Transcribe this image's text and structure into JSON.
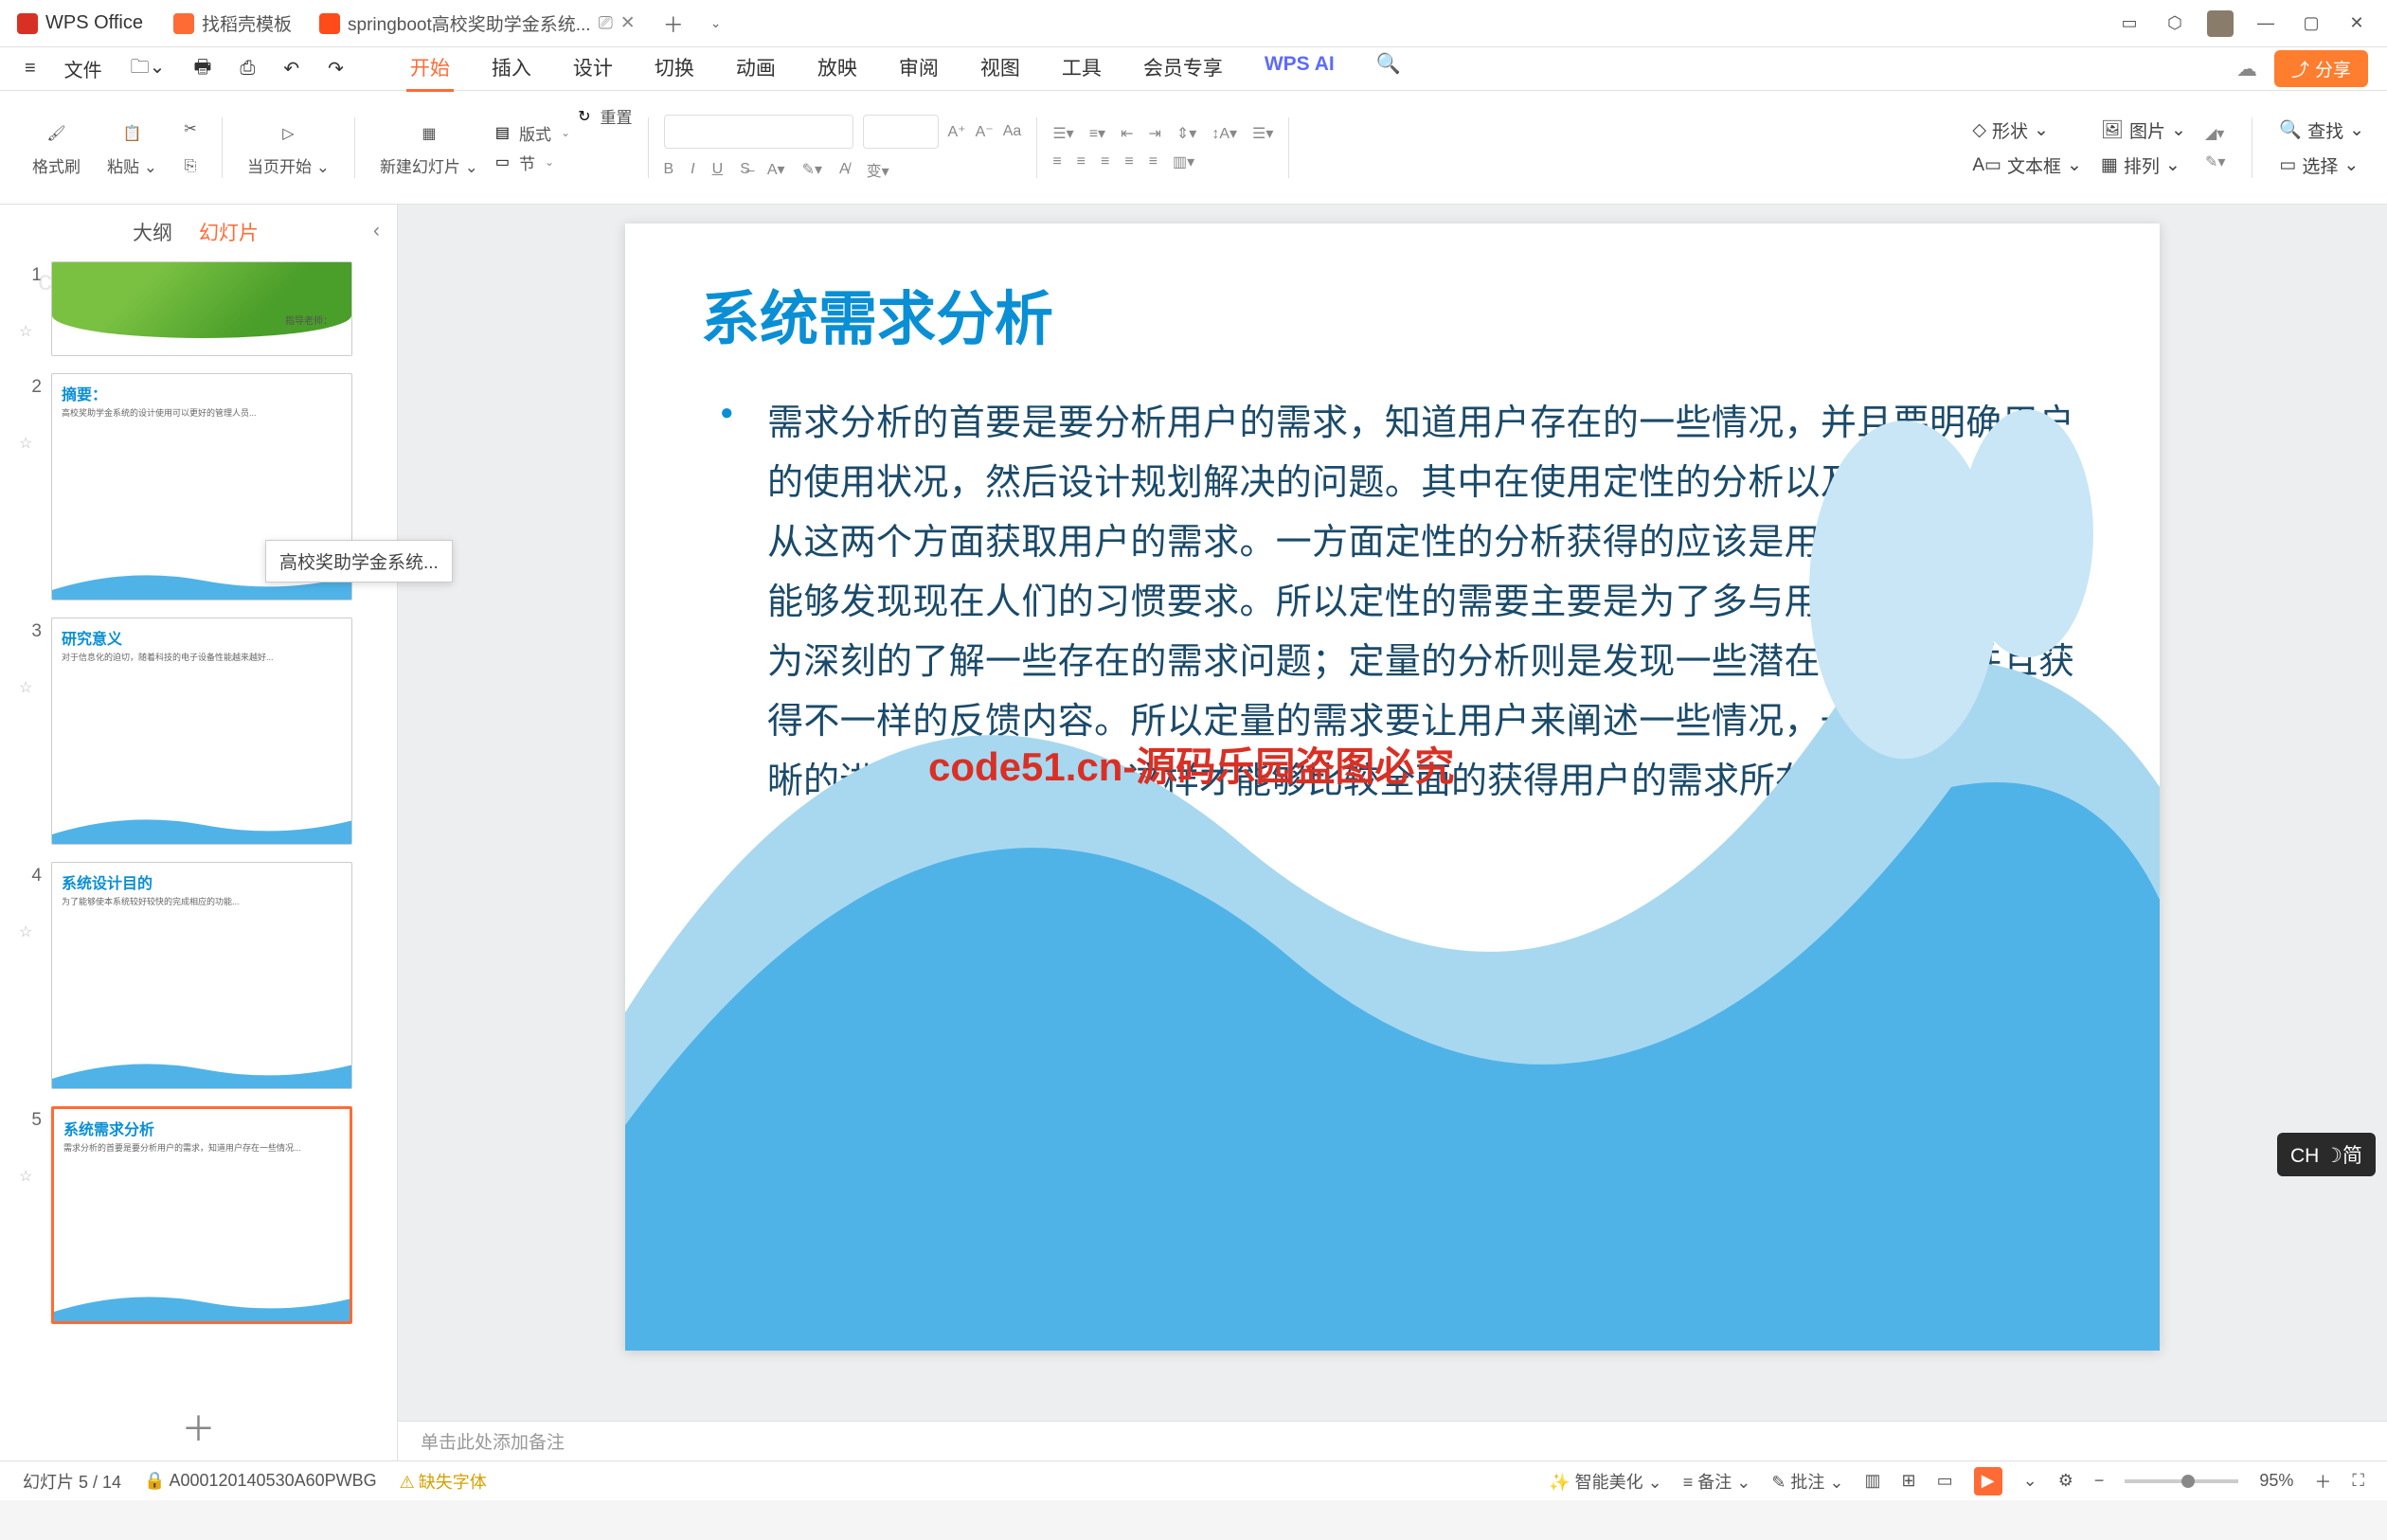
{
  "titlebar": {
    "app_name": "WPS Office",
    "tab2": "找稻壳模板",
    "tab3": "springboot高校奖助学金系统...",
    "window_icons": [
      "⬚",
      "⬡",
      "👤",
      "—",
      "▢",
      "✕"
    ]
  },
  "menubar": {
    "file": "文件",
    "tabs": [
      "开始",
      "插入",
      "设计",
      "切换",
      "动画",
      "放映",
      "审阅",
      "视图",
      "工具",
      "会员专享"
    ],
    "wps_ai": "WPS AI",
    "share": "分享"
  },
  "ribbon": {
    "format_brush": "格式刷",
    "paste": "粘贴",
    "from_current": "当页开始",
    "new_slide": "新建幻灯片",
    "layout": "版式",
    "section": "节",
    "reset": "重置",
    "shape": "形状",
    "picture": "图片",
    "textbox": "文本框",
    "arrange": "排列",
    "find": "查找",
    "select": "选择"
  },
  "sidebar": {
    "tab_outline": "大纲",
    "tab_slides": "幻灯片",
    "thumbs": [
      {
        "num": "1",
        "title": "",
        "subtitle": "指导老师："
      },
      {
        "num": "2",
        "title": "摘要：",
        "body": "高校奖助学金系统的设计使用可以更好的管理人员..."
      },
      {
        "num": "3",
        "title": "研究意义",
        "body": "对于信息化的迫切，随着科技的电子设备性能越来越好..."
      },
      {
        "num": "4",
        "title": "系统设计目的",
        "body": "为了能够使本系统较好较快的完成相应的功能..."
      },
      {
        "num": "5",
        "title": "系统需求分析",
        "body": "需求分析的首要是要分析用户的需求，知道用户存在一些情况..."
      }
    ],
    "tooltip": "高校奖助学金系统..."
  },
  "slide": {
    "title": "系统需求分析",
    "body": "需求分析的首要是要分析用户的需求，知道用户存在的一些情况，并且要明确用户的使用状况，然后设计规划解决的问题。其中在使用定性的分析以及定量的分析，从这两个方面获取用户的需求。一方面定性的分析获得的应该是用户的基本需求，能够发现现在人们的习惯要求。所以定性的需要主要是为了多与用户交流，从而更为深刻的了解一些存在的需求问题；定量的分析则是发现一些潜在的用户，并且获得不一样的反馈内容。所以定量的需求要让用户来阐述一些情况，一定让使用者清晰的进行客观的描述，这样才能够比较全面的获得用户的需求所在。",
    "overlay": "code51.cn-源码乐园盗图必究"
  },
  "notes": {
    "placeholder": "单击此处添加备注"
  },
  "statusbar": {
    "slide_info": "幻灯片 5 / 14",
    "doc_id": "A000120140530A60PWBG",
    "missing_font": "缺失字体",
    "smart_beauty": "智能美化",
    "notes_btn": "备注",
    "review_btn": "批注",
    "zoom": "95%"
  },
  "ime": "CH ☽简",
  "watermark": "code51.cn"
}
